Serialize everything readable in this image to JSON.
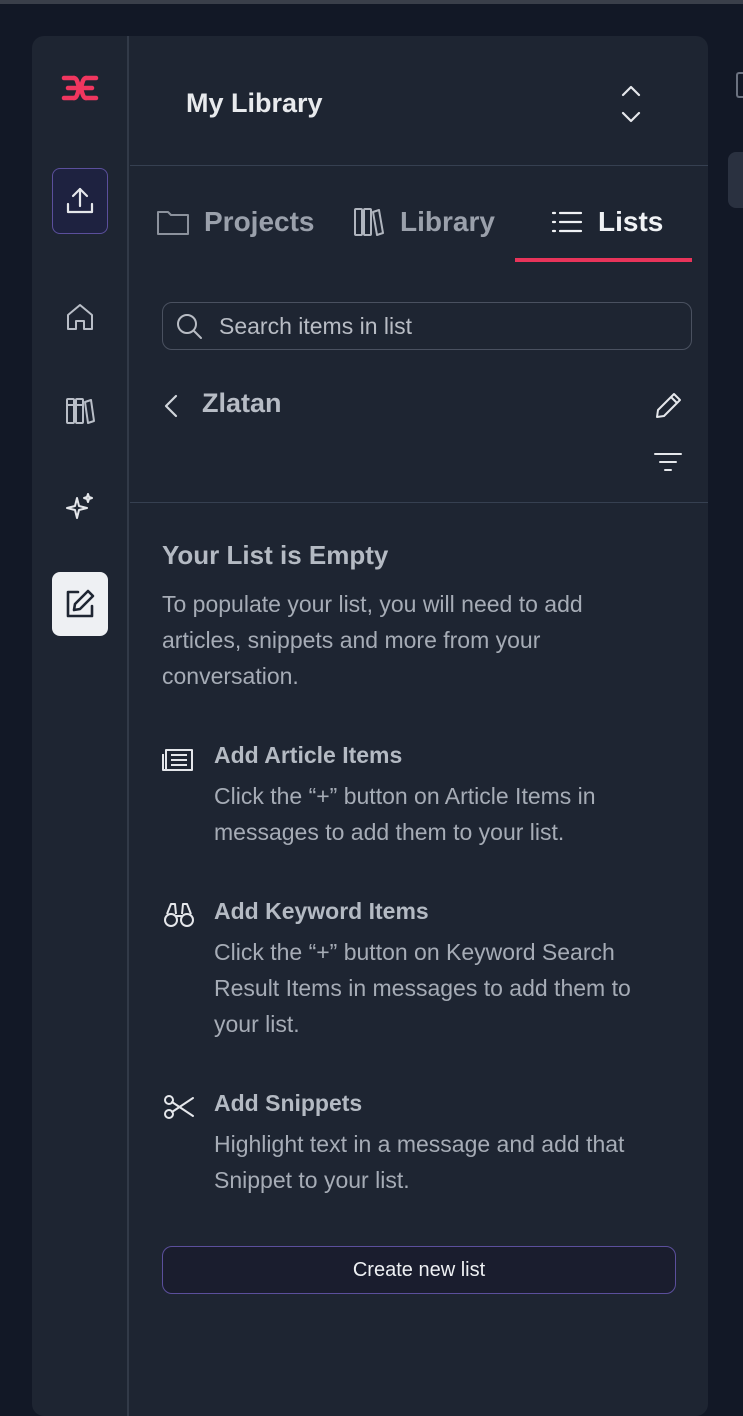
{
  "header": {
    "title": "My Library"
  },
  "tabs": [
    {
      "label": "Projects",
      "icon": "folder-icon"
    },
    {
      "label": "Library",
      "icon": "books-icon"
    },
    {
      "label": "Lists",
      "icon": "list-icon",
      "active": true
    }
  ],
  "search": {
    "placeholder": "Search items in list"
  },
  "list": {
    "name": "Zlatan"
  },
  "empty": {
    "title": "Your List is Empty",
    "description": "To populate your list, you will need to add articles, snippets and more from your conversation."
  },
  "hints": [
    {
      "icon": "article-icon",
      "title": "Add Article Items",
      "text": "Click the “+” button on Article Items in messages to add them to your list."
    },
    {
      "icon": "binoculars-icon",
      "title": "Add Keyword Items",
      "text": "Click the “+” button on Keyword Search Result Items in messages to add them to your list."
    },
    {
      "icon": "scissors-icon",
      "title": "Add Snippets",
      "text": "Highlight text in a message and add that Snippet to your list."
    }
  ],
  "actions": {
    "create_label": "Create new list"
  },
  "colors": {
    "accent": "#e8345a",
    "button_border": "#5b4f9c",
    "background": "#1e2532"
  }
}
